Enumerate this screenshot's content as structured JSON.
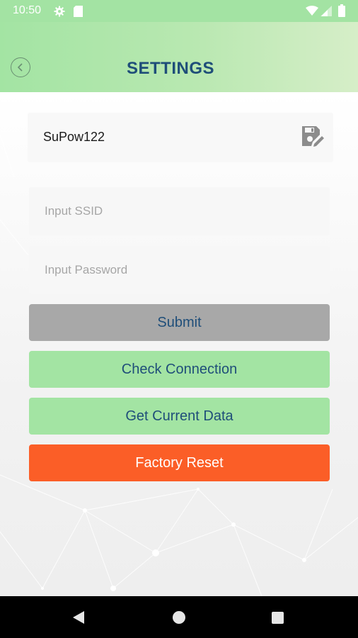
{
  "status_bar": {
    "time": "10:50",
    "icons": [
      "gear-icon",
      "sd-card-icon",
      "wifi-icon",
      "signal-icon",
      "battery-icon"
    ]
  },
  "header": {
    "title": "SETTINGS",
    "back_icon": "chevron-left-circle-icon"
  },
  "device": {
    "name": "SuPow122",
    "edit_icon": "save-edit-icon"
  },
  "form": {
    "ssid_placeholder": "Input SSID",
    "password_placeholder": "Input Password",
    "ssid_value": "",
    "password_value": ""
  },
  "buttons": {
    "submit": "Submit",
    "check_connection": "Check Connection",
    "get_current_data": "Get Current Data",
    "factory_reset": "Factory Reset"
  },
  "nav": {
    "icons": [
      "back-triangle-icon",
      "home-circle-icon",
      "recents-square-icon"
    ]
  },
  "colors": {
    "accent_green": "#a3e4a3",
    "title_blue": "#1f4e79",
    "reset_orange": "#fb5e27",
    "submit_gray": "#a8a8a8"
  }
}
